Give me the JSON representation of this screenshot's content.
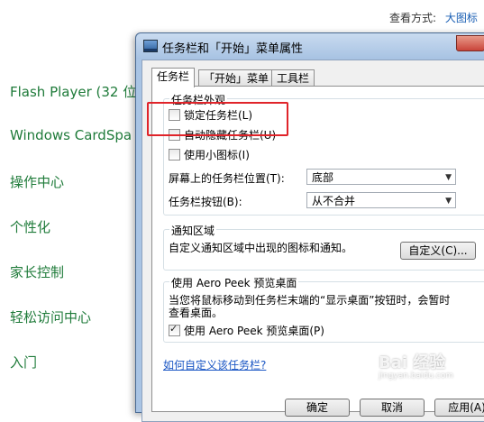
{
  "control_panel": {
    "view_by_label": "查看方式:",
    "view_by_value": "大图标",
    "items": [
      {
        "label": "Flash Player (32 位"
      },
      {
        "label": "Windows CardSpa"
      },
      {
        "label": "操作中心"
      },
      {
        "label": "个性化"
      },
      {
        "label": "家长控制"
      },
      {
        "label": "轻松访问中心"
      },
      {
        "label": "入门"
      }
    ]
  },
  "dialog": {
    "title": "任务栏和「开始」菜单属性",
    "tabs": [
      "任务栏",
      "「开始」菜单",
      "工具栏"
    ],
    "appearance": {
      "group_title": "任务栏外观",
      "lock_taskbar": {
        "label": "锁定任务栏(L)",
        "checked": false
      },
      "auto_hide": {
        "label": "自动隐藏任务栏(U)",
        "checked": false
      },
      "small_icons": {
        "label": "使用小图标(I)",
        "checked": false
      },
      "location_label": "屏幕上的任务栏位置(T):",
      "location_value": "底部",
      "buttons_label": "任务栏按钮(B):",
      "buttons_value": "从不合并"
    },
    "notification": {
      "group_title": "通知区域",
      "description": "自定义通知区域中出现的图标和通知。",
      "customize_button": "自定义(C)..."
    },
    "aero_peek": {
      "group_title": "使用 Aero Peek 预览桌面",
      "description_line1": "当您将鼠标移动到任务栏末端的“显示桌面”按钮时，会暂时",
      "description_line2": "查看桌面。",
      "checkbox": {
        "label": "使用 Aero Peek 预览桌面(P)",
        "checked": true
      }
    },
    "help_link": "如何自定义该任务栏?",
    "buttons": {
      "ok": "确定",
      "cancel": "取消",
      "apply": "应用(A)"
    }
  },
  "colors": {
    "highlight": "#e0242a",
    "control_panel_link": "#1f7b3a",
    "link": "#1a56c4"
  },
  "watermark": {
    "text": "Bai 经验",
    "subtext": "jingyan.baidu.com"
  }
}
